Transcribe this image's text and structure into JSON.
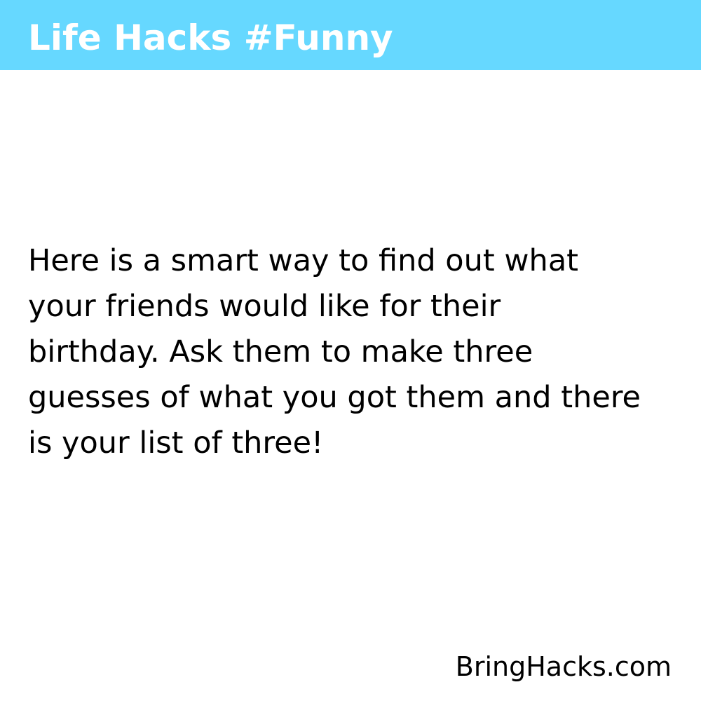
{
  "header": {
    "title": "Life Hacks #Funny",
    "background_color": "#66d8ff",
    "text_color": "#ffffff"
  },
  "hack": {
    "lines": [
      "Here is a smart way to find out what",
      "your friends would like for their",
      "birthday. Ask them to make three",
      "guesses of what you got them and there",
      "is your list of three!"
    ]
  },
  "footer": {
    "site": "BringHacks.com"
  }
}
